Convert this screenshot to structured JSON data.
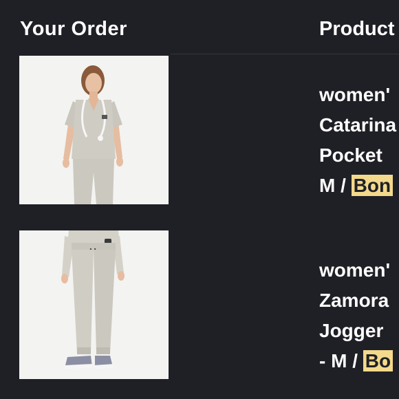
{
  "header": {
    "title": "Your Order",
    "column_label": "Product"
  },
  "items": [
    {
      "line1": "women'",
      "line2": "Catarina",
      "line3": "Pocket",
      "size_prefix": "M /",
      "color": "Bon"
    },
    {
      "line1": "women'",
      "line2": "Zamora",
      "line3": "Jogger",
      "size_prefix": "- M /",
      "color": "Bo"
    }
  ],
  "colors": {
    "background": "#1f2026",
    "text": "#ffffff",
    "highlight": "#f3d98b"
  }
}
